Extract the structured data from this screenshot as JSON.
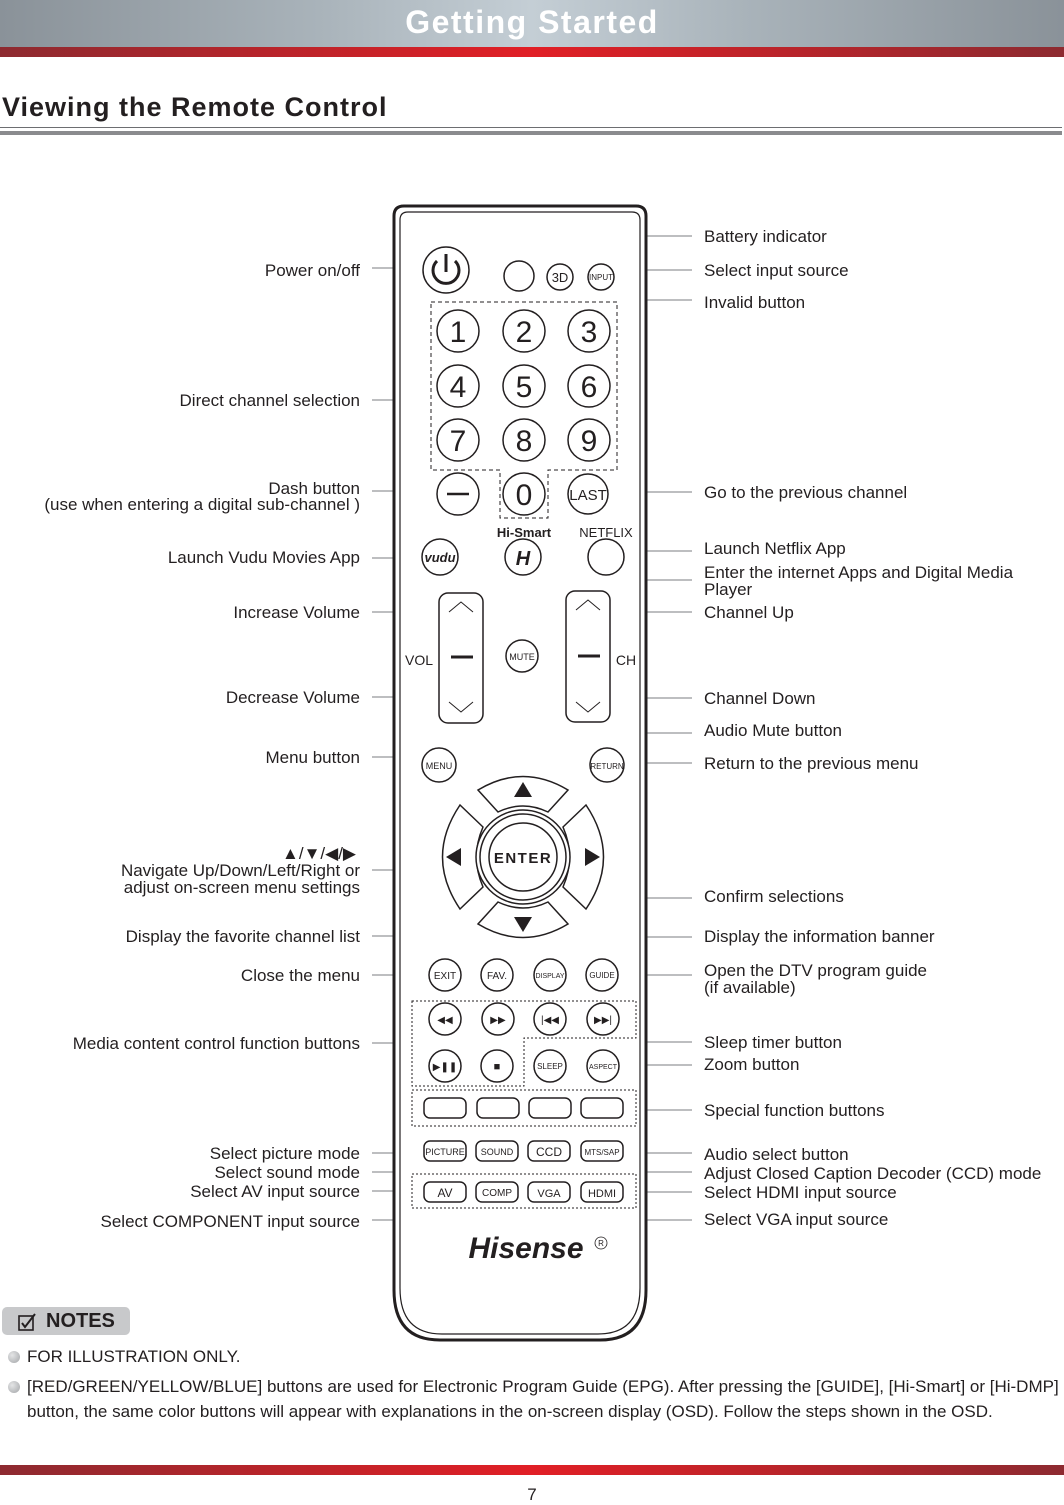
{
  "header": {
    "title": "Getting Started"
  },
  "section": {
    "title": "Viewing the Remote Control"
  },
  "remote": {
    "brand": "Hisense",
    "registered_mark": "R",
    "buttons": {
      "power": "power-icon",
      "battery": "",
      "three_d": "3D",
      "input": "INPUT",
      "digits": [
        "1",
        "2",
        "3",
        "4",
        "5",
        "6",
        "7",
        "8",
        "9"
      ],
      "dash": "—",
      "zero": "0",
      "last": "LAST",
      "hi_smart_caption": "Hi-Smart",
      "hi_smart": "H",
      "netflix_caption": "NETFLIX",
      "vudu": "vudu",
      "vol": "VOL",
      "ch": "CH",
      "mute": "MUTE",
      "menu": "MENU",
      "return": "RETURN",
      "enter": "ENTER",
      "exit": "EXIT",
      "fav": "FAV.",
      "display": "DISPLAY",
      "guide": "GUIDE",
      "rewind": "◀◀",
      "fast_forward": "▶▶",
      "prev": "|◀◀",
      "next": "▶▶|",
      "play_pause": "▶❚❚",
      "stop": "■",
      "sleep": "SLEEP",
      "aspect": "ASPECT",
      "picture": "PICTURE",
      "sound": "SOUND",
      "ccd": "CCD",
      "mts_sap": "MTS/SAP",
      "av": "AV",
      "comp": "COMP",
      "vga": "VGA",
      "hdmi": "HDMI"
    }
  },
  "callouts_left": [
    {
      "text": "Power on/off"
    },
    {
      "text": "Direct channel selection"
    },
    {
      "text": "Dash button",
      "text2": "(use when entering a digital sub-channel )"
    },
    {
      "text": "Launch Vudu Movies App"
    },
    {
      "text": "Increase Volume"
    },
    {
      "text": "Decrease Volume"
    },
    {
      "text": "Menu button"
    },
    {
      "text": "▲/▼/◀/▶",
      "text2": "Navigate Up/Down/Left/Right or",
      "text3": "adjust on-screen menu settings"
    },
    {
      "text": "Display the favorite channel list"
    },
    {
      "text": "Close the menu"
    },
    {
      "text": "Media content control function buttons"
    },
    {
      "text": "Select picture mode"
    },
    {
      "text": "Select sound mode"
    },
    {
      "text": "Select AV input source"
    },
    {
      "text": "Select COMPONENT input source"
    }
  ],
  "callouts_right": [
    {
      "text": "Battery indicator"
    },
    {
      "text": "Select input source"
    },
    {
      "text": "Invalid button"
    },
    {
      "text": "Go to the previous channel"
    },
    {
      "text": "Launch Netflix App"
    },
    {
      "text": "Enter the internet Apps and Digital Media",
      "text2": "Player"
    },
    {
      "text": "Channel Up"
    },
    {
      "text": "Channel Down"
    },
    {
      "text": "Audio Mute button"
    },
    {
      "text": "Return to the previous menu"
    },
    {
      "text": "Confirm selections"
    },
    {
      "text": "Display the information banner"
    },
    {
      "text": "Open the DTV program guide",
      "text2": "(if available)"
    },
    {
      "text": "Sleep timer button"
    },
    {
      "text": "Zoom button"
    },
    {
      "text": "Special function buttons"
    },
    {
      "text": "Audio select button"
    },
    {
      "text": "Adjust Closed Caption Decoder (CCD) mode"
    },
    {
      "text": "Select HDMI input source"
    },
    {
      "text": "Select VGA input source"
    }
  ],
  "notes": {
    "title": "NOTES",
    "icon": "checkbox-pencil-icon",
    "items": [
      "FOR ILLUSTRATION ONLY.",
      "[RED/GREEN/YELLOW/BLUE] buttons are used for Electronic Program Guide (EPG). After pressing the [GUIDE], [Hi-Smart] or [Hi-DMP] button, the same color buttons will appear with explanations in the on-screen display (OSD). Follow the steps shown in the OSD."
    ]
  },
  "footer": {
    "page_number": "7"
  },
  "colors": {
    "accent_red": "#e11f26",
    "header_gray": "#a9b3ba",
    "text": "#231f20",
    "leader_line": "#a7a9ac"
  }
}
